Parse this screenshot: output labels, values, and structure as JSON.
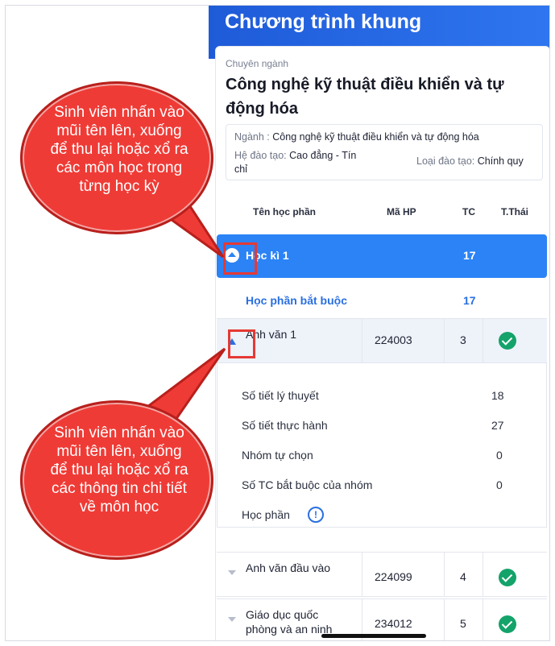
{
  "app": {
    "title": "Chương trình khung",
    "major_caption": "Chuyên ngành",
    "major_name": "Công nghệ kỹ thuật điều khiển và tự động hóa",
    "info": {
      "nganh_key": "Ngành :",
      "nganh_val": "Công nghệ kỹ thuật điều khiển và tự động hóa",
      "he_key": "Hệ đào tạo:",
      "he_val": "Cao đẳng - Tín chỉ",
      "loai_key": "Loại đào tạo:",
      "loai_val": "Chính quy"
    },
    "table_headers": {
      "name": "Tên học phần",
      "code": "Mã HP",
      "tc": "TC",
      "status": "T.Thái"
    },
    "semester": {
      "label": "Học kì 1",
      "tc": "17"
    },
    "group": {
      "label": "Học phần bắt buộc",
      "tc": "17"
    },
    "courses": [
      {
        "name": "Anh văn 1",
        "code": "224003",
        "tc": "3",
        "status_icon": "check-circle-icon"
      },
      {
        "name": "Anh văn đầu vào",
        "code": "224099",
        "tc": "4",
        "status_icon": "check-circle-icon"
      },
      {
        "name": "Giáo dục quốc phòng và an ninh",
        "code": "234012",
        "tc": "5",
        "status_icon": "check-circle-icon"
      }
    ],
    "detail": {
      "rows": [
        {
          "label": "Số tiết lý thuyết",
          "value": "18"
        },
        {
          "label": "Số tiết thực hành",
          "value": "27"
        },
        {
          "label": "Nhóm tự chọn",
          "value": "0"
        },
        {
          "label": "Số TC bắt buộc của nhóm",
          "value": "0"
        }
      ],
      "hoc_phan_label": "Học phần",
      "info_glyph": "!"
    }
  },
  "callouts": {
    "top": "Sinh viên nhấn vào mũi tên lên, xuống để thu lại hoặc xổ ra các môn học trong từng học kỳ",
    "bottom": "Sinh viên nhấn vào mũi tên lên, xuống để thu lại hoặc xổ ra các thông tin chi tiết về môn học"
  },
  "colors": {
    "header_blue": "#2f76f0",
    "semester_blue": "#2b83f6",
    "link_blue": "#2a6fe0",
    "check_green": "#14a36a",
    "callout_red": "#ef3b36"
  }
}
